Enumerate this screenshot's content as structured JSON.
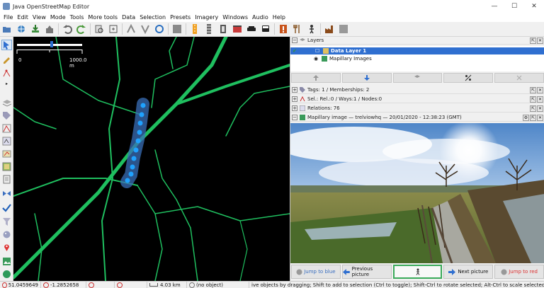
{
  "window": {
    "title": "Java OpenStreetMap Editor",
    "controls": [
      "—",
      "☐",
      "✕"
    ]
  },
  "menu": [
    "File",
    "Edit",
    "View",
    "Mode",
    "Tools",
    "More tools",
    "Data",
    "Selection",
    "Presets",
    "Imagery",
    "Windows",
    "Audio",
    "Help"
  ],
  "map": {
    "scale_start": "0",
    "scale_end": "1000.0 m"
  },
  "panels": {
    "layers": {
      "title": "Layers",
      "items": [
        {
          "name": "Data Layer 1",
          "active": true
        },
        {
          "name": "Mapillary Images",
          "active": false
        }
      ]
    },
    "tags": "Tags: 1 / Memberships: 2",
    "selection": "Sel.: Rel.:0 / Ways:1 / Nodes:0",
    "relations": "Relations: 76",
    "mapillary": "Mapillary image — trelviowhq — 20/01/2020 - 12:38:23 (GMT)"
  },
  "image_buttons": {
    "jump_blue": "Jump to blue",
    "previous": "Previous picture",
    "next": "Next picture",
    "jump_red": "Jump to red"
  },
  "status": {
    "lat": "51.0459649",
    "lon": "-1.2852658",
    "distance": "4.03 km",
    "object": "(no object)",
    "help": "ive objects by dragging; Shift to add to selection (Ctrl to toggle); Shift-Ctrl to rotate selected; Alt-Ctrl to scale selected; or change selection"
  },
  "colors": {
    "road": "#22c55e",
    "selection_blue": "#2f6fd0",
    "marker": "#1fa2ff"
  }
}
